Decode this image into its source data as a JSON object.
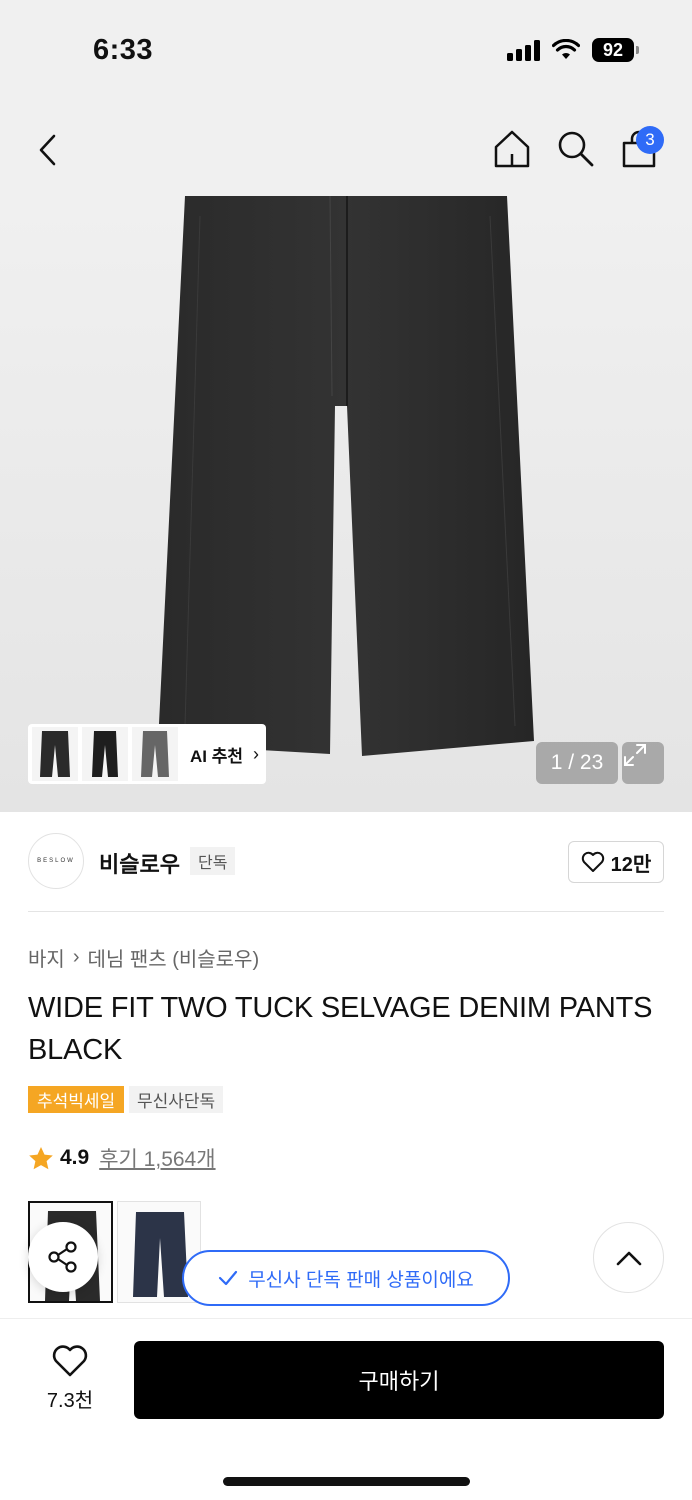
{
  "status_bar": {
    "time": "6:33",
    "battery": "92"
  },
  "nav": {
    "cart_count": "3"
  },
  "hero": {
    "ai_label": "AI 추천",
    "ai_arrow": "›",
    "page_counter": "1 / 23"
  },
  "brand": {
    "logo_text": "BESLOW",
    "name": "비슬로우",
    "tag": "단독",
    "likes": "12만"
  },
  "breadcrumb": {
    "category": "바지",
    "separator": "›",
    "subcategory": "데님 팬츠 (비슬로우)"
  },
  "product": {
    "title": "WIDE FIT TWO TUCK SELVAGE DENIM PANTS BLACK",
    "tags": [
      "추석빅세일",
      "무신사단독"
    ],
    "rating": "4.9",
    "reviews": "후기 1,564개"
  },
  "toast": "무신사 단독 판매 상품이에요",
  "bottom": {
    "wish_count": "7.3천",
    "buy_label": "구매하기"
  },
  "colors": {
    "accent_blue": "#2f6bf7",
    "sale_orange": "#f5a623",
    "star": "#f5a623"
  },
  "icons": [
    "back-icon",
    "home-icon",
    "search-icon",
    "shopping-bag-icon",
    "expand-icon",
    "heart-icon",
    "star-icon",
    "share-icon",
    "check-icon",
    "chevron-up-icon"
  ]
}
